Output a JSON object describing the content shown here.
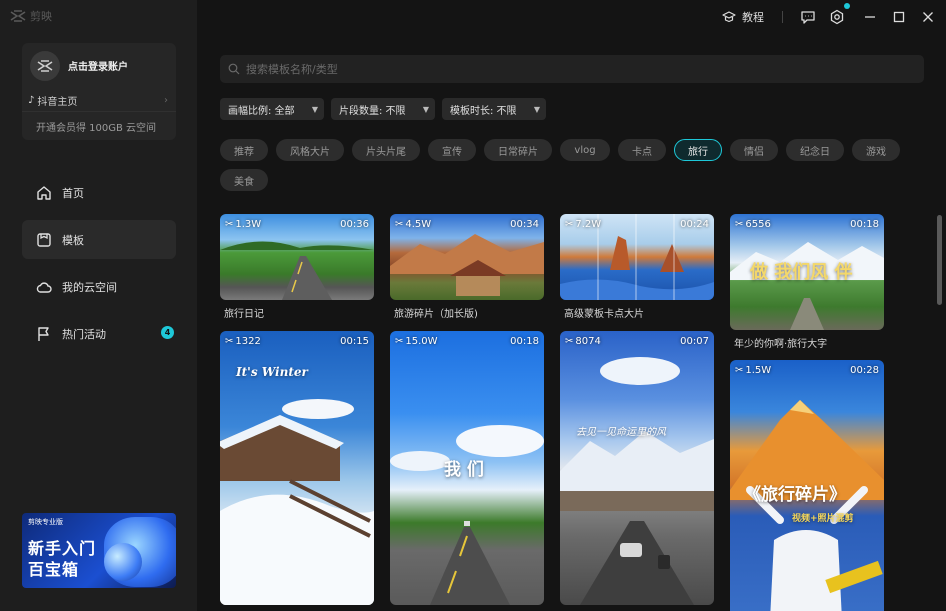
{
  "app": {
    "name": "剪映"
  },
  "account": {
    "login": "点击登录账户",
    "douyin": "抖音主页",
    "vip": "开通会员得 100GB 云空间"
  },
  "nav": [
    {
      "label": "首页",
      "icon": "home-icon"
    },
    {
      "label": "模板",
      "icon": "template-icon",
      "active": true
    },
    {
      "label": "我的云空间",
      "icon": "cloud-icon"
    },
    {
      "label": "热门活动",
      "icon": "flag-icon",
      "badge": "4"
    }
  ],
  "promo": {
    "tag": "剪映专业版",
    "line1": "新手入门",
    "line2": "百宝箱"
  },
  "topbar": {
    "tutorial": "教程"
  },
  "search": {
    "placeholder": "搜索模板名称/类型"
  },
  "filters": [
    {
      "label": "画幅比例: 全部"
    },
    {
      "label": "片段数量: 不限"
    },
    {
      "label": "模板时长: 不限"
    }
  ],
  "categories": [
    "推荐",
    "风格大片",
    "片头片尾",
    "宣传",
    "日常碎片",
    "vlog",
    "卡点",
    "旅行",
    "情侣",
    "纪念日",
    "游戏",
    "美食"
  ],
  "active_category": "旅行",
  "cards": [
    {
      "uses": "1.3W",
      "duration": "00:36",
      "title": "旅行日记"
    },
    {
      "uses": "4.5W",
      "duration": "00:34",
      "title": "旅游碎片（加长版)"
    },
    {
      "uses": "7.2W",
      "duration": "00:24",
      "title": "高级蒙板卡点大片"
    },
    {
      "uses": "6556",
      "duration": "00:18",
      "title": "年少的你啊·旅行大字",
      "overlay": "做 我们风 伴"
    },
    {
      "uses": "1322",
      "duration": "00:15",
      "title": "",
      "overlay": "It's Winter"
    },
    {
      "uses": "15.0W",
      "duration": "00:18",
      "title": "",
      "overlay": "我 们"
    },
    {
      "uses": "8074",
      "duration": "00:07",
      "title": "",
      "overlay": "去见一见命运里的风"
    },
    {
      "uses": "1.5W",
      "duration": "00:28",
      "title": "",
      "overlay": "《旅行碎片》",
      "overlay2": "视频+照片混剪"
    }
  ],
  "colors": {
    "accent": "#1ec8d8",
    "sidebar": "#1e1e1e",
    "background": "#141414"
  }
}
